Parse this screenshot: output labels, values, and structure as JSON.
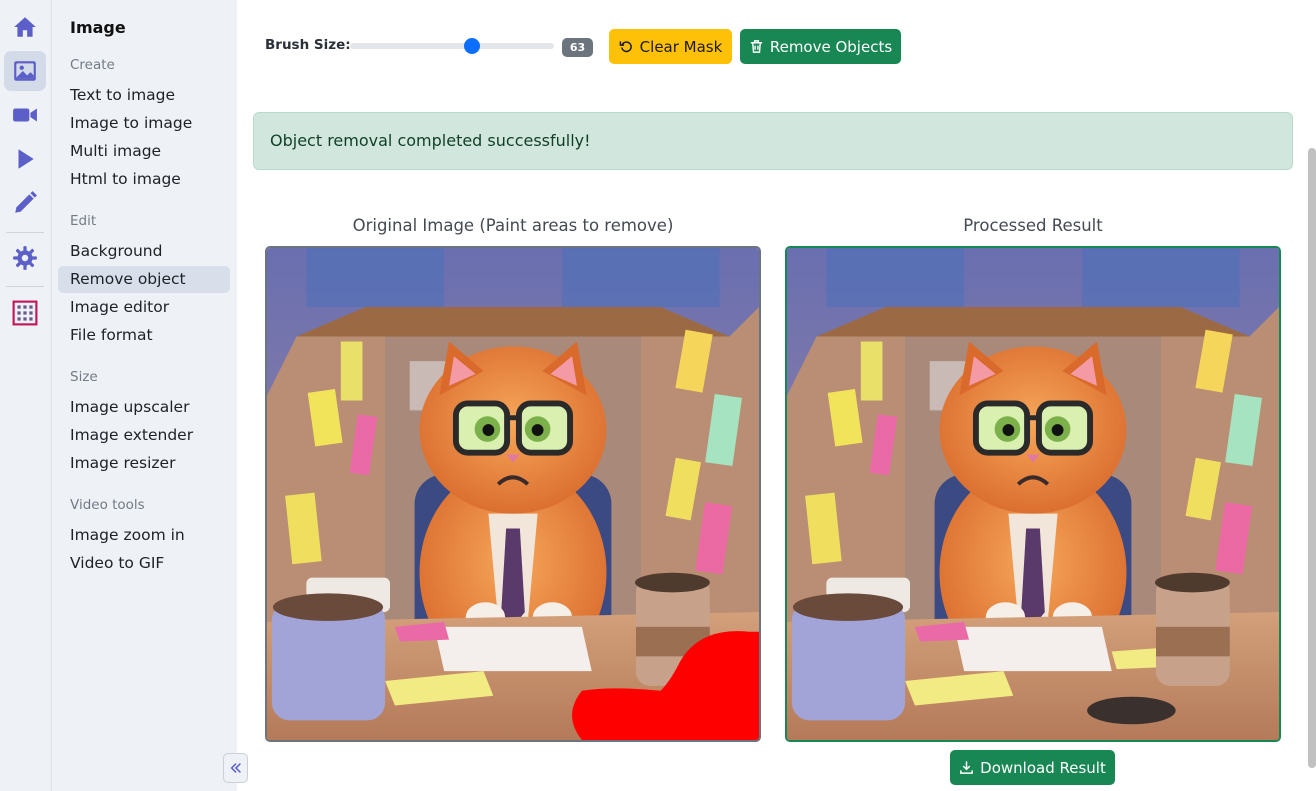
{
  "rail": {
    "items": [
      {
        "icon": "home-icon"
      },
      {
        "icon": "image-icon",
        "active": true
      },
      {
        "icon": "video-camera-icon"
      },
      {
        "icon": "play-icon"
      },
      {
        "icon": "pencil-icon"
      },
      {
        "icon": "settings-gear-icon"
      },
      {
        "icon": "calculator-grid-icon"
      }
    ],
    "accent_color": "#5b5fc7"
  },
  "menu": {
    "title": "Image",
    "groups": {
      "create": "Create",
      "edit": "Edit",
      "size": "Size",
      "video_tools": "Video tools"
    },
    "items": {
      "text_to_image": "Text to image",
      "image_to_image": "Image to image",
      "multi_image": "Multi image",
      "html_to_image": "Html to image",
      "background": "Background",
      "remove_object": "Remove object",
      "image_editor": "Image editor",
      "file_format": "File format",
      "image_upscaler": "Image upscaler",
      "image_extender": "Image extender",
      "image_resizer": "Image resizer",
      "image_zoom_in": "Image zoom in",
      "video_to_gif": "Video to GIF"
    },
    "active_item": "Remove object",
    "collapse_icon": "double-chevron-left-icon"
  },
  "toolbar": {
    "brush_label": "Brush Size:",
    "brush_value": "63",
    "brush_fraction": 0.6,
    "clear_mask_label": "Clear Mask",
    "clear_mask_icon": "rotate-ccw-icon",
    "remove_objects_label": "Remove Objects",
    "remove_objects_icon": "trash-icon"
  },
  "alert": {
    "message": "Object removal completed successfully!",
    "color": "#d1e7dd"
  },
  "panels": {
    "original_title": "Original Image (Paint areas to remove)",
    "result_title": "Processed Result",
    "mask_color": "#ff0000"
  },
  "download": {
    "label": "Download Result",
    "icon": "download-icon"
  },
  "colors": {
    "success": "#198754",
    "warning": "#ffc107",
    "primary": "#0d6efd"
  }
}
